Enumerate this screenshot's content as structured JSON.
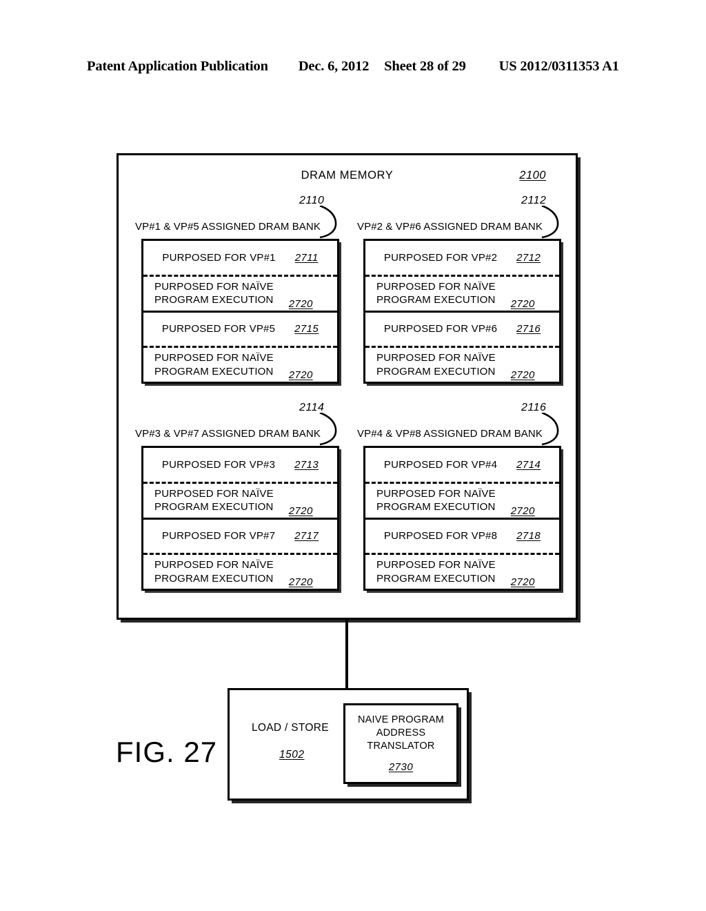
{
  "header": {
    "publication": "Patent Application Publication",
    "date": "Dec. 6, 2012",
    "sheet": "Sheet 28 of 29",
    "patent_number": "US 2012/0311353 A1"
  },
  "figure": {
    "label": "FIG. 27"
  },
  "dram": {
    "title": "DRAM MEMORY",
    "ref": "2100"
  },
  "quadrants": [
    {
      "caption": "VP#1 & VP#5 ASSIGNED DRAM BANK",
      "ref": "2110",
      "rows": [
        {
          "type": "vp",
          "label": "PURPOSED FOR VP#1",
          "ref": "2711"
        },
        {
          "type": "naive",
          "line1": "PURPOSED FOR NAÏVE",
          "line2": "PROGRAM EXECUTION",
          "ref": "2720"
        },
        {
          "type": "vp",
          "label": "PURPOSED FOR VP#5",
          "ref": "2715"
        },
        {
          "type": "naive",
          "line1": "PURPOSED FOR NAÏVE",
          "line2": "PROGRAM EXECUTION",
          "ref": "2720"
        }
      ]
    },
    {
      "caption": "VP#2 & VP#6 ASSIGNED DRAM BANK",
      "ref": "2112",
      "rows": [
        {
          "type": "vp",
          "label": "PURPOSED FOR VP#2",
          "ref": "2712"
        },
        {
          "type": "naive",
          "line1": "PURPOSED FOR NAÏVE",
          "line2": "PROGRAM EXECUTION",
          "ref": "2720"
        },
        {
          "type": "vp",
          "label": "PURPOSED FOR VP#6",
          "ref": "2716"
        },
        {
          "type": "naive",
          "line1": "PURPOSED FOR NAÏVE",
          "line2": "PROGRAM EXECUTION",
          "ref": "2720"
        }
      ]
    },
    {
      "caption": "VP#3 & VP#7 ASSIGNED DRAM BANK",
      "ref": "2114",
      "rows": [
        {
          "type": "vp",
          "label": "PURPOSED FOR VP#3",
          "ref": "2713"
        },
        {
          "type": "naive",
          "line1": "PURPOSED FOR NAÏVE",
          "line2": "PROGRAM EXECUTION",
          "ref": "2720"
        },
        {
          "type": "vp",
          "label": "PURPOSED FOR VP#7",
          "ref": "2717"
        },
        {
          "type": "naive",
          "line1": "PURPOSED FOR NAÏVE",
          "line2": "PROGRAM EXECUTION",
          "ref": "2720"
        }
      ]
    },
    {
      "caption": "VP#4 & VP#8 ASSIGNED DRAM BANK",
      "ref": "2116",
      "rows": [
        {
          "type": "vp",
          "label": "PURPOSED FOR VP#4",
          "ref": "2714"
        },
        {
          "type": "naive",
          "line1": "PURPOSED FOR NAÏVE",
          "line2": "PROGRAM EXECUTION",
          "ref": "2720"
        },
        {
          "type": "vp",
          "label": "PURPOSED FOR VP#8",
          "ref": "2718"
        },
        {
          "type": "naive",
          "line1": "PURPOSED FOR NAÏVE",
          "line2": "PROGRAM EXECUTION",
          "ref": "2720"
        }
      ]
    }
  ],
  "loadstore": {
    "label": "LOAD / STORE",
    "ref": "1502",
    "translator": {
      "line1": "NAIVE PROGRAM",
      "line2": "ADDRESS",
      "line3": "TRANSLATOR",
      "ref": "2730"
    }
  },
  "colors": {
    "ink": "#000000",
    "page": "#ffffff"
  }
}
